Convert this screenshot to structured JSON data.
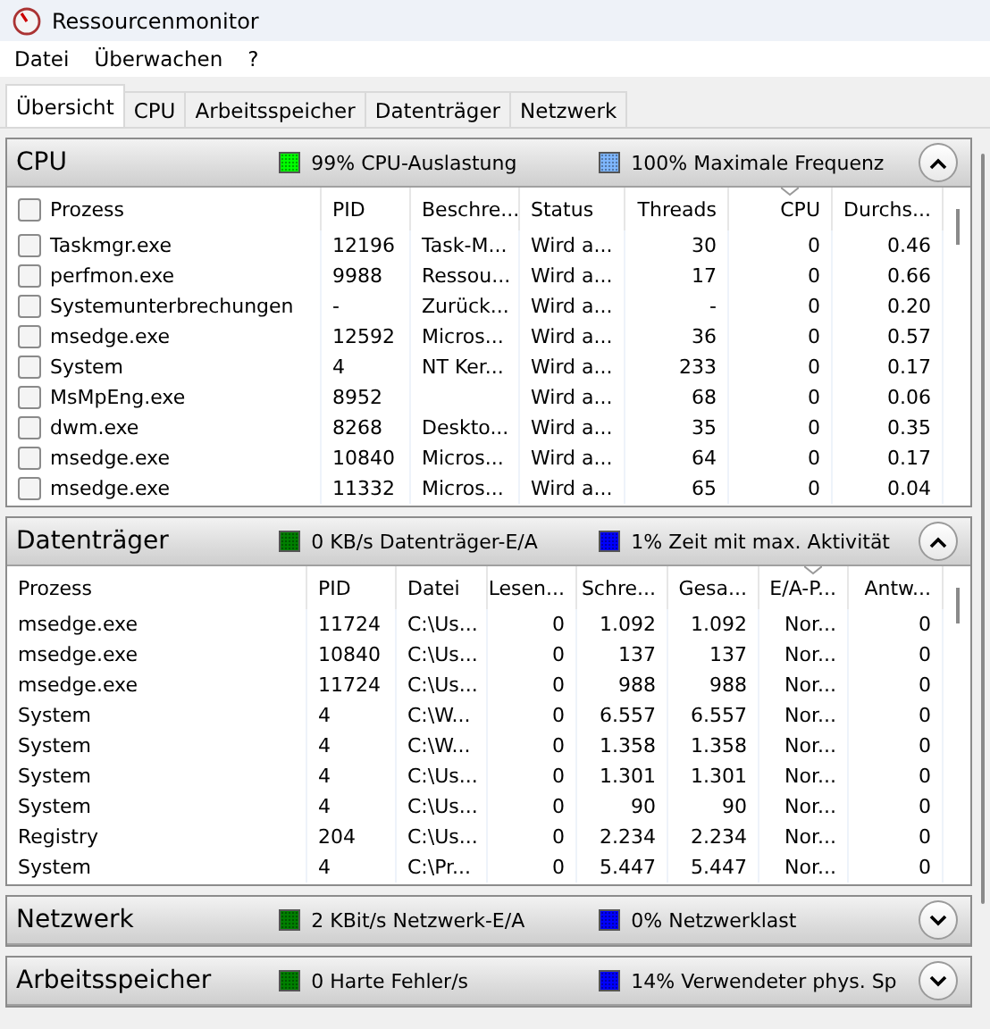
{
  "window": {
    "title": "Ressourcenmonitor"
  },
  "menu": [
    {
      "label": "Datei"
    },
    {
      "label": "Überwachen"
    },
    {
      "label": "?"
    }
  ],
  "tabs": [
    {
      "label": "Übersicht",
      "selected": true
    },
    {
      "label": "CPU",
      "selected": false
    },
    {
      "label": "Arbeitsspeicher",
      "selected": false
    },
    {
      "label": "Datenträger",
      "selected": false
    },
    {
      "label": "Netzwerk",
      "selected": false
    }
  ],
  "sections": [
    {
      "title": "CPU",
      "expanded": true,
      "header_checked": false,
      "indicators": [
        {
          "text": "99% CPU-Auslastung",
          "color": "#00ff00"
        },
        {
          "text": "100% Maximale Frequenz",
          "color": "#7fb7ff"
        }
      ],
      "columns": [
        {
          "label": "Prozess",
          "kind": "text",
          "sorted": false
        },
        {
          "label": "PID",
          "kind": "text",
          "sorted": false
        },
        {
          "label": "Beschre...",
          "kind": "text",
          "sorted": false
        },
        {
          "label": "Status",
          "kind": "text",
          "sorted": false
        },
        {
          "label": "Threads",
          "kind": "number",
          "sorted": false
        },
        {
          "label": "CPU",
          "kind": "number",
          "sorted": true
        },
        {
          "label": "Durchs...",
          "kind": "number",
          "sorted": false
        }
      ],
      "rows": [
        {
          "checked": false,
          "cells": [
            "Taskmgr.exe",
            "12196",
            "Task-M...",
            "Wird a...",
            "30",
            "0",
            "0.46"
          ]
        },
        {
          "checked": false,
          "cells": [
            "perfmon.exe",
            "9988",
            "Ressou...",
            "Wird a...",
            "17",
            "0",
            "0.66"
          ]
        },
        {
          "checked": false,
          "cells": [
            "Systemunterbrechungen",
            "-",
            "Zurück...",
            "Wird a...",
            "-",
            "0",
            "0.20"
          ]
        },
        {
          "checked": false,
          "cells": [
            "msedge.exe",
            "12592",
            "Micros...",
            "Wird a...",
            "36",
            "0",
            "0.57"
          ]
        },
        {
          "checked": false,
          "cells": [
            "System",
            "4",
            "NT Ker...",
            "Wird a...",
            "233",
            "0",
            "0.17"
          ]
        },
        {
          "checked": false,
          "cells": [
            "MsMpEng.exe",
            "8952",
            "",
            "Wird a...",
            "68",
            "0",
            "0.06"
          ]
        },
        {
          "checked": false,
          "cells": [
            "dwm.exe",
            "8268",
            "Deskto...",
            "Wird a...",
            "35",
            "0",
            "0.35"
          ]
        },
        {
          "checked": false,
          "cells": [
            "msedge.exe",
            "10840",
            "Micros...",
            "Wird a...",
            "64",
            "0",
            "0.17"
          ]
        },
        {
          "checked": false,
          "cells": [
            "msedge.exe",
            "11332",
            "Micros...",
            "Wird a...",
            "65",
            "0",
            "0.04"
          ]
        }
      ]
    },
    {
      "title": "Datenträger",
      "expanded": true,
      "indicators": [
        {
          "text": "0 KB/s Datenträger-E/A",
          "color": "#008000"
        },
        {
          "text": "1% Zeit mit max. Aktivität",
          "color": "#0000ff"
        }
      ],
      "columns": [
        {
          "label": "Prozess",
          "kind": "text",
          "sorted": false
        },
        {
          "label": "PID",
          "kind": "text",
          "sorted": false
        },
        {
          "label": "Datei",
          "kind": "text",
          "sorted": false
        },
        {
          "label": "Lesen...",
          "kind": "number",
          "sorted": false
        },
        {
          "label": "Schre...",
          "kind": "number",
          "sorted": false
        },
        {
          "label": "Gesa...",
          "kind": "number",
          "sorted": false
        },
        {
          "label": "E/A-P...",
          "kind": "number",
          "sorted": true
        },
        {
          "label": "Antw...",
          "kind": "number",
          "sorted": false
        }
      ],
      "rows": [
        {
          "cells": [
            "msedge.exe",
            "11724",
            "C:\\Us...",
            "0",
            "1.092",
            "1.092",
            "Nor...",
            "0"
          ]
        },
        {
          "cells": [
            "msedge.exe",
            "10840",
            "C:\\Us...",
            "0",
            "137",
            "137",
            "Nor...",
            "0"
          ]
        },
        {
          "cells": [
            "msedge.exe",
            "11724",
            "C:\\Us...",
            "0",
            "988",
            "988",
            "Nor...",
            "0"
          ]
        },
        {
          "cells": [
            "System",
            "4",
            "C:\\W...",
            "0",
            "6.557",
            "6.557",
            "Nor...",
            "0"
          ]
        },
        {
          "cells": [
            "System",
            "4",
            "C:\\W...",
            "0",
            "1.358",
            "1.358",
            "Nor...",
            "0"
          ]
        },
        {
          "cells": [
            "System",
            "4",
            "C:\\Us...",
            "0",
            "1.301",
            "1.301",
            "Nor...",
            "0"
          ]
        },
        {
          "cells": [
            "System",
            "4",
            "C:\\Us...",
            "0",
            "90",
            "90",
            "Nor...",
            "0"
          ]
        },
        {
          "cells": [
            "Registry",
            "204",
            "C:\\Us...",
            "0",
            "2.234",
            "2.234",
            "Nor...",
            "0"
          ]
        },
        {
          "cells": [
            "System",
            "4",
            "C:\\Pr...",
            "0",
            "5.447",
            "5.447",
            "Nor...",
            "0"
          ]
        }
      ]
    },
    {
      "title": "Netzwerk",
      "expanded": false,
      "indicators": [
        {
          "text": "2 KBit/s Netzwerk-E/A",
          "color": "#008000"
        },
        {
          "text": "0% Netzwerklast",
          "color": "#0000ff"
        }
      ]
    },
    {
      "title": "Arbeitsspeicher",
      "expanded": false,
      "indicators": [
        {
          "text": "0 Harte Fehler/s",
          "color": "#008000"
        },
        {
          "text": "14% Verwendeter phys. Sp",
          "color": "#0000ff"
        }
      ]
    }
  ]
}
